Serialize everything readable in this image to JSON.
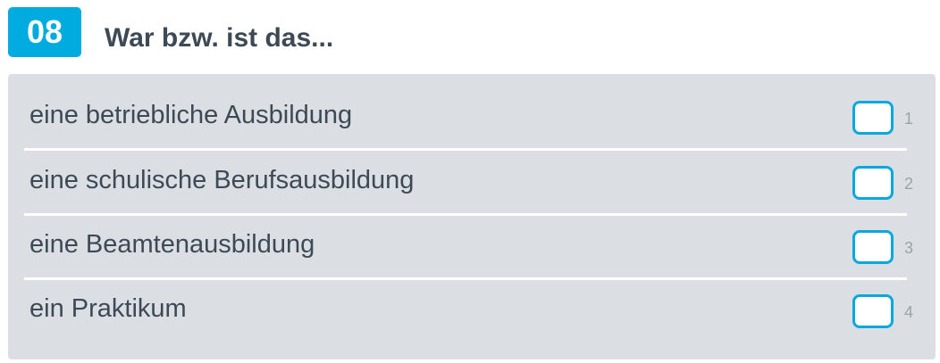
{
  "question": {
    "number": "08",
    "title": "War bzw. ist das..."
  },
  "options": [
    {
      "label": "eine betriebliche Ausbildung",
      "code": "1",
      "checked": false
    },
    {
      "label": "eine schulische Berufsausbildung",
      "code": "2",
      "checked": false
    },
    {
      "label": "eine Beamtenausbildung",
      "code": "3",
      "checked": false
    },
    {
      "label": "ein Praktikum",
      "code": "4",
      "checked": false
    }
  ],
  "colors": {
    "accent": "#00abe0",
    "panel": "#dbdfe3",
    "text": "#3d4a55"
  }
}
